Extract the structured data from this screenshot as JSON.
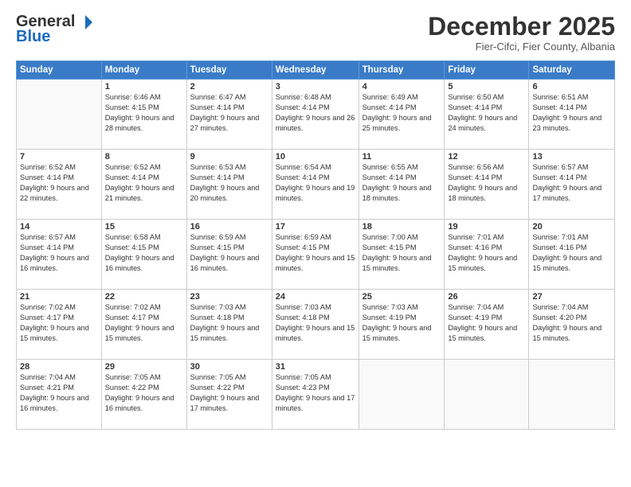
{
  "logo": {
    "general": "General",
    "blue": "Blue"
  },
  "header": {
    "month_title": "December 2025",
    "subtitle": "Fier-Cifci, Fier County, Albania"
  },
  "weekdays": [
    "Sunday",
    "Monday",
    "Tuesday",
    "Wednesday",
    "Thursday",
    "Friday",
    "Saturday"
  ],
  "weeks": [
    [
      {
        "day": "",
        "sunrise": "",
        "sunset": "",
        "daylight": ""
      },
      {
        "day": "1",
        "sunrise": "Sunrise: 6:46 AM",
        "sunset": "Sunset: 4:15 PM",
        "daylight": "Daylight: 9 hours and 28 minutes."
      },
      {
        "day": "2",
        "sunrise": "Sunrise: 6:47 AM",
        "sunset": "Sunset: 4:14 PM",
        "daylight": "Daylight: 9 hours and 27 minutes."
      },
      {
        "day": "3",
        "sunrise": "Sunrise: 6:48 AM",
        "sunset": "Sunset: 4:14 PM",
        "daylight": "Daylight: 9 hours and 26 minutes."
      },
      {
        "day": "4",
        "sunrise": "Sunrise: 6:49 AM",
        "sunset": "Sunset: 4:14 PM",
        "daylight": "Daylight: 9 hours and 25 minutes."
      },
      {
        "day": "5",
        "sunrise": "Sunrise: 6:50 AM",
        "sunset": "Sunset: 4:14 PM",
        "daylight": "Daylight: 9 hours and 24 minutes."
      },
      {
        "day": "6",
        "sunrise": "Sunrise: 6:51 AM",
        "sunset": "Sunset: 4:14 PM",
        "daylight": "Daylight: 9 hours and 23 minutes."
      }
    ],
    [
      {
        "day": "7",
        "sunrise": "Sunrise: 6:52 AM",
        "sunset": "Sunset: 4:14 PM",
        "daylight": "Daylight: 9 hours and 22 minutes."
      },
      {
        "day": "8",
        "sunrise": "Sunrise: 6:52 AM",
        "sunset": "Sunset: 4:14 PM",
        "daylight": "Daylight: 9 hours and 21 minutes."
      },
      {
        "day": "9",
        "sunrise": "Sunrise: 6:53 AM",
        "sunset": "Sunset: 4:14 PM",
        "daylight": "Daylight: 9 hours and 20 minutes."
      },
      {
        "day": "10",
        "sunrise": "Sunrise: 6:54 AM",
        "sunset": "Sunset: 4:14 PM",
        "daylight": "Daylight: 9 hours and 19 minutes."
      },
      {
        "day": "11",
        "sunrise": "Sunrise: 6:55 AM",
        "sunset": "Sunset: 4:14 PM",
        "daylight": "Daylight: 9 hours and 18 minutes."
      },
      {
        "day": "12",
        "sunrise": "Sunrise: 6:56 AM",
        "sunset": "Sunset: 4:14 PM",
        "daylight": "Daylight: 9 hours and 18 minutes."
      },
      {
        "day": "13",
        "sunrise": "Sunrise: 6:57 AM",
        "sunset": "Sunset: 4:14 PM",
        "daylight": "Daylight: 9 hours and 17 minutes."
      }
    ],
    [
      {
        "day": "14",
        "sunrise": "Sunrise: 6:57 AM",
        "sunset": "Sunset: 4:14 PM",
        "daylight": "Daylight: 9 hours and 16 minutes."
      },
      {
        "day": "15",
        "sunrise": "Sunrise: 6:58 AM",
        "sunset": "Sunset: 4:15 PM",
        "daylight": "Daylight: 9 hours and 16 minutes."
      },
      {
        "day": "16",
        "sunrise": "Sunrise: 6:59 AM",
        "sunset": "Sunset: 4:15 PM",
        "daylight": "Daylight: 9 hours and 16 minutes."
      },
      {
        "day": "17",
        "sunrise": "Sunrise: 6:59 AM",
        "sunset": "Sunset: 4:15 PM",
        "daylight": "Daylight: 9 hours and 15 minutes."
      },
      {
        "day": "18",
        "sunrise": "Sunrise: 7:00 AM",
        "sunset": "Sunset: 4:15 PM",
        "daylight": "Daylight: 9 hours and 15 minutes."
      },
      {
        "day": "19",
        "sunrise": "Sunrise: 7:01 AM",
        "sunset": "Sunset: 4:16 PM",
        "daylight": "Daylight: 9 hours and 15 minutes."
      },
      {
        "day": "20",
        "sunrise": "Sunrise: 7:01 AM",
        "sunset": "Sunset: 4:16 PM",
        "daylight": "Daylight: 9 hours and 15 minutes."
      }
    ],
    [
      {
        "day": "21",
        "sunrise": "Sunrise: 7:02 AM",
        "sunset": "Sunset: 4:17 PM",
        "daylight": "Daylight: 9 hours and 15 minutes."
      },
      {
        "day": "22",
        "sunrise": "Sunrise: 7:02 AM",
        "sunset": "Sunset: 4:17 PM",
        "daylight": "Daylight: 9 hours and 15 minutes."
      },
      {
        "day": "23",
        "sunrise": "Sunrise: 7:03 AM",
        "sunset": "Sunset: 4:18 PM",
        "daylight": "Daylight: 9 hours and 15 minutes."
      },
      {
        "day": "24",
        "sunrise": "Sunrise: 7:03 AM",
        "sunset": "Sunset: 4:18 PM",
        "daylight": "Daylight: 9 hours and 15 minutes."
      },
      {
        "day": "25",
        "sunrise": "Sunrise: 7:03 AM",
        "sunset": "Sunset: 4:19 PM",
        "daylight": "Daylight: 9 hours and 15 minutes."
      },
      {
        "day": "26",
        "sunrise": "Sunrise: 7:04 AM",
        "sunset": "Sunset: 4:19 PM",
        "daylight": "Daylight: 9 hours and 15 minutes."
      },
      {
        "day": "27",
        "sunrise": "Sunrise: 7:04 AM",
        "sunset": "Sunset: 4:20 PM",
        "daylight": "Daylight: 9 hours and 15 minutes."
      }
    ],
    [
      {
        "day": "28",
        "sunrise": "Sunrise: 7:04 AM",
        "sunset": "Sunset: 4:21 PM",
        "daylight": "Daylight: 9 hours and 16 minutes."
      },
      {
        "day": "29",
        "sunrise": "Sunrise: 7:05 AM",
        "sunset": "Sunset: 4:22 PM",
        "daylight": "Daylight: 9 hours and 16 minutes."
      },
      {
        "day": "30",
        "sunrise": "Sunrise: 7:05 AM",
        "sunset": "Sunset: 4:22 PM",
        "daylight": "Daylight: 9 hours and 17 minutes."
      },
      {
        "day": "31",
        "sunrise": "Sunrise: 7:05 AM",
        "sunset": "Sunset: 4:23 PM",
        "daylight": "Daylight: 9 hours and 17 minutes."
      },
      {
        "day": "",
        "sunrise": "",
        "sunset": "",
        "daylight": ""
      },
      {
        "day": "",
        "sunrise": "",
        "sunset": "",
        "daylight": ""
      },
      {
        "day": "",
        "sunrise": "",
        "sunset": "",
        "daylight": ""
      }
    ]
  ]
}
